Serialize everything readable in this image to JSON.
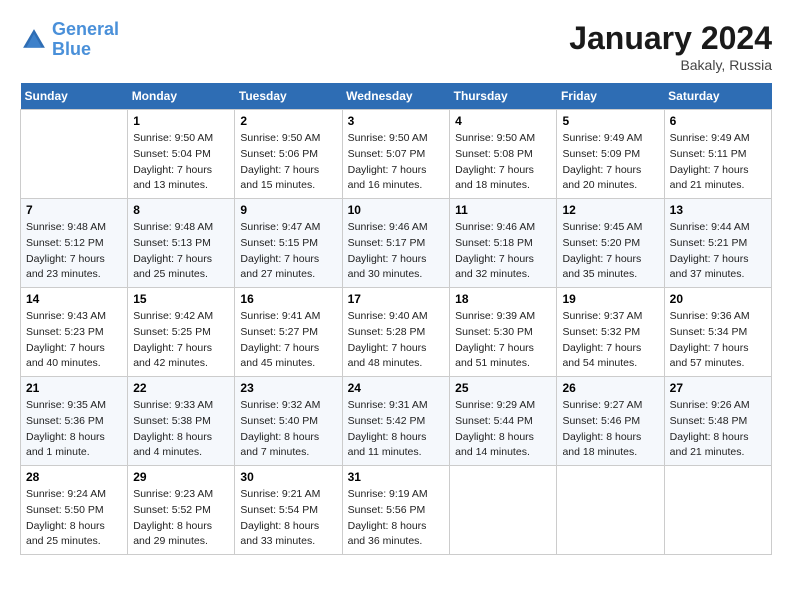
{
  "header": {
    "logo_line1": "General",
    "logo_line2": "Blue",
    "month": "January 2024",
    "location": "Bakaly, Russia"
  },
  "weekdays": [
    "Sunday",
    "Monday",
    "Tuesday",
    "Wednesday",
    "Thursday",
    "Friday",
    "Saturday"
  ],
  "weeks": [
    [
      {
        "day": "",
        "sunrise": "",
        "sunset": "",
        "daylight": ""
      },
      {
        "day": "1",
        "sunrise": "Sunrise: 9:50 AM",
        "sunset": "Sunset: 5:04 PM",
        "daylight": "Daylight: 7 hours and 13 minutes."
      },
      {
        "day": "2",
        "sunrise": "Sunrise: 9:50 AM",
        "sunset": "Sunset: 5:06 PM",
        "daylight": "Daylight: 7 hours and 15 minutes."
      },
      {
        "day": "3",
        "sunrise": "Sunrise: 9:50 AM",
        "sunset": "Sunset: 5:07 PM",
        "daylight": "Daylight: 7 hours and 16 minutes."
      },
      {
        "day": "4",
        "sunrise": "Sunrise: 9:50 AM",
        "sunset": "Sunset: 5:08 PM",
        "daylight": "Daylight: 7 hours and 18 minutes."
      },
      {
        "day": "5",
        "sunrise": "Sunrise: 9:49 AM",
        "sunset": "Sunset: 5:09 PM",
        "daylight": "Daylight: 7 hours and 20 minutes."
      },
      {
        "day": "6",
        "sunrise": "Sunrise: 9:49 AM",
        "sunset": "Sunset: 5:11 PM",
        "daylight": "Daylight: 7 hours and 21 minutes."
      }
    ],
    [
      {
        "day": "7",
        "sunrise": "Sunrise: 9:48 AM",
        "sunset": "Sunset: 5:12 PM",
        "daylight": "Daylight: 7 hours and 23 minutes."
      },
      {
        "day": "8",
        "sunrise": "Sunrise: 9:48 AM",
        "sunset": "Sunset: 5:13 PM",
        "daylight": "Daylight: 7 hours and 25 minutes."
      },
      {
        "day": "9",
        "sunrise": "Sunrise: 9:47 AM",
        "sunset": "Sunset: 5:15 PM",
        "daylight": "Daylight: 7 hours and 27 minutes."
      },
      {
        "day": "10",
        "sunrise": "Sunrise: 9:46 AM",
        "sunset": "Sunset: 5:17 PM",
        "daylight": "Daylight: 7 hours and 30 minutes."
      },
      {
        "day": "11",
        "sunrise": "Sunrise: 9:46 AM",
        "sunset": "Sunset: 5:18 PM",
        "daylight": "Daylight: 7 hours and 32 minutes."
      },
      {
        "day": "12",
        "sunrise": "Sunrise: 9:45 AM",
        "sunset": "Sunset: 5:20 PM",
        "daylight": "Daylight: 7 hours and 35 minutes."
      },
      {
        "day": "13",
        "sunrise": "Sunrise: 9:44 AM",
        "sunset": "Sunset: 5:21 PM",
        "daylight": "Daylight: 7 hours and 37 minutes."
      }
    ],
    [
      {
        "day": "14",
        "sunrise": "Sunrise: 9:43 AM",
        "sunset": "Sunset: 5:23 PM",
        "daylight": "Daylight: 7 hours and 40 minutes."
      },
      {
        "day": "15",
        "sunrise": "Sunrise: 9:42 AM",
        "sunset": "Sunset: 5:25 PM",
        "daylight": "Daylight: 7 hours and 42 minutes."
      },
      {
        "day": "16",
        "sunrise": "Sunrise: 9:41 AM",
        "sunset": "Sunset: 5:27 PM",
        "daylight": "Daylight: 7 hours and 45 minutes."
      },
      {
        "day": "17",
        "sunrise": "Sunrise: 9:40 AM",
        "sunset": "Sunset: 5:28 PM",
        "daylight": "Daylight: 7 hours and 48 minutes."
      },
      {
        "day": "18",
        "sunrise": "Sunrise: 9:39 AM",
        "sunset": "Sunset: 5:30 PM",
        "daylight": "Daylight: 7 hours and 51 minutes."
      },
      {
        "day": "19",
        "sunrise": "Sunrise: 9:37 AM",
        "sunset": "Sunset: 5:32 PM",
        "daylight": "Daylight: 7 hours and 54 minutes."
      },
      {
        "day": "20",
        "sunrise": "Sunrise: 9:36 AM",
        "sunset": "Sunset: 5:34 PM",
        "daylight": "Daylight: 7 hours and 57 minutes."
      }
    ],
    [
      {
        "day": "21",
        "sunrise": "Sunrise: 9:35 AM",
        "sunset": "Sunset: 5:36 PM",
        "daylight": "Daylight: 8 hours and 1 minute."
      },
      {
        "day": "22",
        "sunrise": "Sunrise: 9:33 AM",
        "sunset": "Sunset: 5:38 PM",
        "daylight": "Daylight: 8 hours and 4 minutes."
      },
      {
        "day": "23",
        "sunrise": "Sunrise: 9:32 AM",
        "sunset": "Sunset: 5:40 PM",
        "daylight": "Daylight: 8 hours and 7 minutes."
      },
      {
        "day": "24",
        "sunrise": "Sunrise: 9:31 AM",
        "sunset": "Sunset: 5:42 PM",
        "daylight": "Daylight: 8 hours and 11 minutes."
      },
      {
        "day": "25",
        "sunrise": "Sunrise: 9:29 AM",
        "sunset": "Sunset: 5:44 PM",
        "daylight": "Daylight: 8 hours and 14 minutes."
      },
      {
        "day": "26",
        "sunrise": "Sunrise: 9:27 AM",
        "sunset": "Sunset: 5:46 PM",
        "daylight": "Daylight: 8 hours and 18 minutes."
      },
      {
        "day": "27",
        "sunrise": "Sunrise: 9:26 AM",
        "sunset": "Sunset: 5:48 PM",
        "daylight": "Daylight: 8 hours and 21 minutes."
      }
    ],
    [
      {
        "day": "28",
        "sunrise": "Sunrise: 9:24 AM",
        "sunset": "Sunset: 5:50 PM",
        "daylight": "Daylight: 8 hours and 25 minutes."
      },
      {
        "day": "29",
        "sunrise": "Sunrise: 9:23 AM",
        "sunset": "Sunset: 5:52 PM",
        "daylight": "Daylight: 8 hours and 29 minutes."
      },
      {
        "day": "30",
        "sunrise": "Sunrise: 9:21 AM",
        "sunset": "Sunset: 5:54 PM",
        "daylight": "Daylight: 8 hours and 33 minutes."
      },
      {
        "day": "31",
        "sunrise": "Sunrise: 9:19 AM",
        "sunset": "Sunset: 5:56 PM",
        "daylight": "Daylight: 8 hours and 36 minutes."
      },
      {
        "day": "",
        "sunrise": "",
        "sunset": "",
        "daylight": ""
      },
      {
        "day": "",
        "sunrise": "",
        "sunset": "",
        "daylight": ""
      },
      {
        "day": "",
        "sunrise": "",
        "sunset": "",
        "daylight": ""
      }
    ]
  ]
}
